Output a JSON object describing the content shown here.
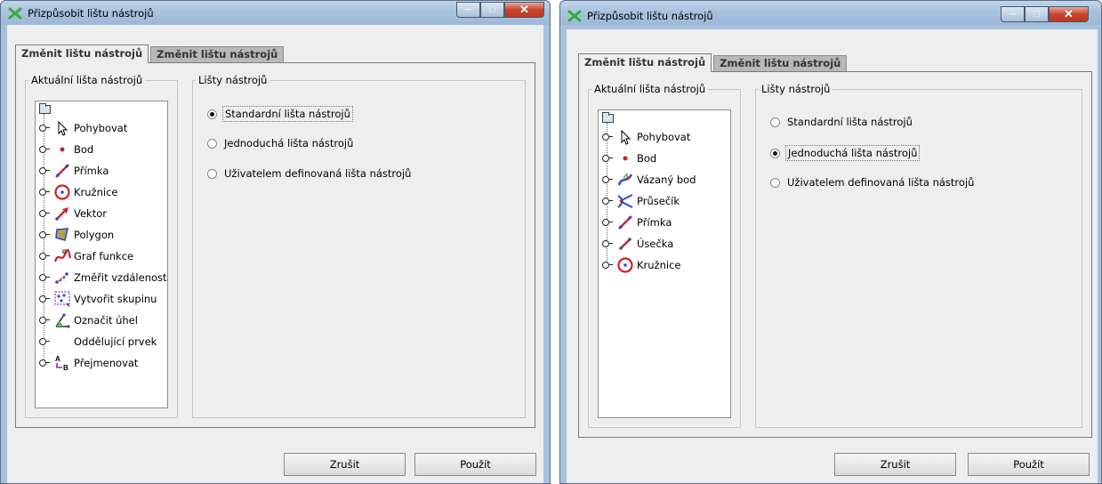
{
  "windows": [
    {
      "title": "Přizpůsobit lištu nástrojů",
      "tabs": [
        "Změnit lištu nástrojů",
        "Změnit lištu nástrojů"
      ],
      "current_toolbar_legend": "Aktuální lišta nástrojů",
      "toolbars_legend": "Lišty nástrojů",
      "tools": [
        {
          "label": "Pohybovat",
          "icon": "move-arrow-icon"
        },
        {
          "label": "Bod",
          "icon": "point-icon"
        },
        {
          "label": "Přímka",
          "icon": "line-icon"
        },
        {
          "label": "Kružnice",
          "icon": "circle-icon"
        },
        {
          "label": "Vektor",
          "icon": "vector-icon"
        },
        {
          "label": "Polygon",
          "icon": "polygon-icon"
        },
        {
          "label": "Graf funkce",
          "icon": "function-graph-icon"
        },
        {
          "label": "Změřit vzdálenost",
          "icon": "measure-distance-icon"
        },
        {
          "label": "Vytvořit skupinu",
          "icon": "create-group-icon"
        },
        {
          "label": "Označit úhel",
          "icon": "angle-icon"
        },
        {
          "label": "Oddělující prvek",
          "icon": "separator-icon"
        },
        {
          "label": "Přejmenovat",
          "icon": "rename-icon"
        }
      ],
      "radio_options": [
        {
          "label": "Standardní lišta nástrojů",
          "checked": true
        },
        {
          "label": "Jednoduchá lišta nástrojů",
          "checked": false
        },
        {
          "label": "Uživatelem definovaná lišta nástrojů",
          "checked": false
        }
      ],
      "cancel_label": "Zrušit",
      "apply_label": "Použít"
    },
    {
      "title": "Přizpůsobit lištu nástrojů",
      "tabs": [
        "Změnit lištu nástrojů",
        "Změnit lištu nástrojů"
      ],
      "current_toolbar_legend": "Aktuální lišta nástrojů",
      "toolbars_legend": "Lišty nástrojů",
      "tools": [
        {
          "label": "Pohybovat",
          "icon": "move-arrow-icon"
        },
        {
          "label": "Bod",
          "icon": "point-icon"
        },
        {
          "label": "Vázaný bod",
          "icon": "attached-point-icon"
        },
        {
          "label": "Průsečík",
          "icon": "intersection-icon"
        },
        {
          "label": "Přímka",
          "icon": "line-icon"
        },
        {
          "label": "Úsečka",
          "icon": "segment-icon"
        },
        {
          "label": "Kružnice",
          "icon": "circle-icon"
        }
      ],
      "radio_options": [
        {
          "label": "Standardní lišta nástrojů",
          "checked": false
        },
        {
          "label": "Jednoduchá lišta nástrojů",
          "checked": true
        },
        {
          "label": "Uživatelem definovaná lišta nástrojů",
          "checked": false
        }
      ],
      "cancel_label": "Zrušit",
      "apply_label": "Použít"
    }
  ],
  "colors": {
    "accent_red": "#d0202a",
    "accent_blue": "#2a4bd4",
    "title_bar": "#a9c2dc"
  }
}
